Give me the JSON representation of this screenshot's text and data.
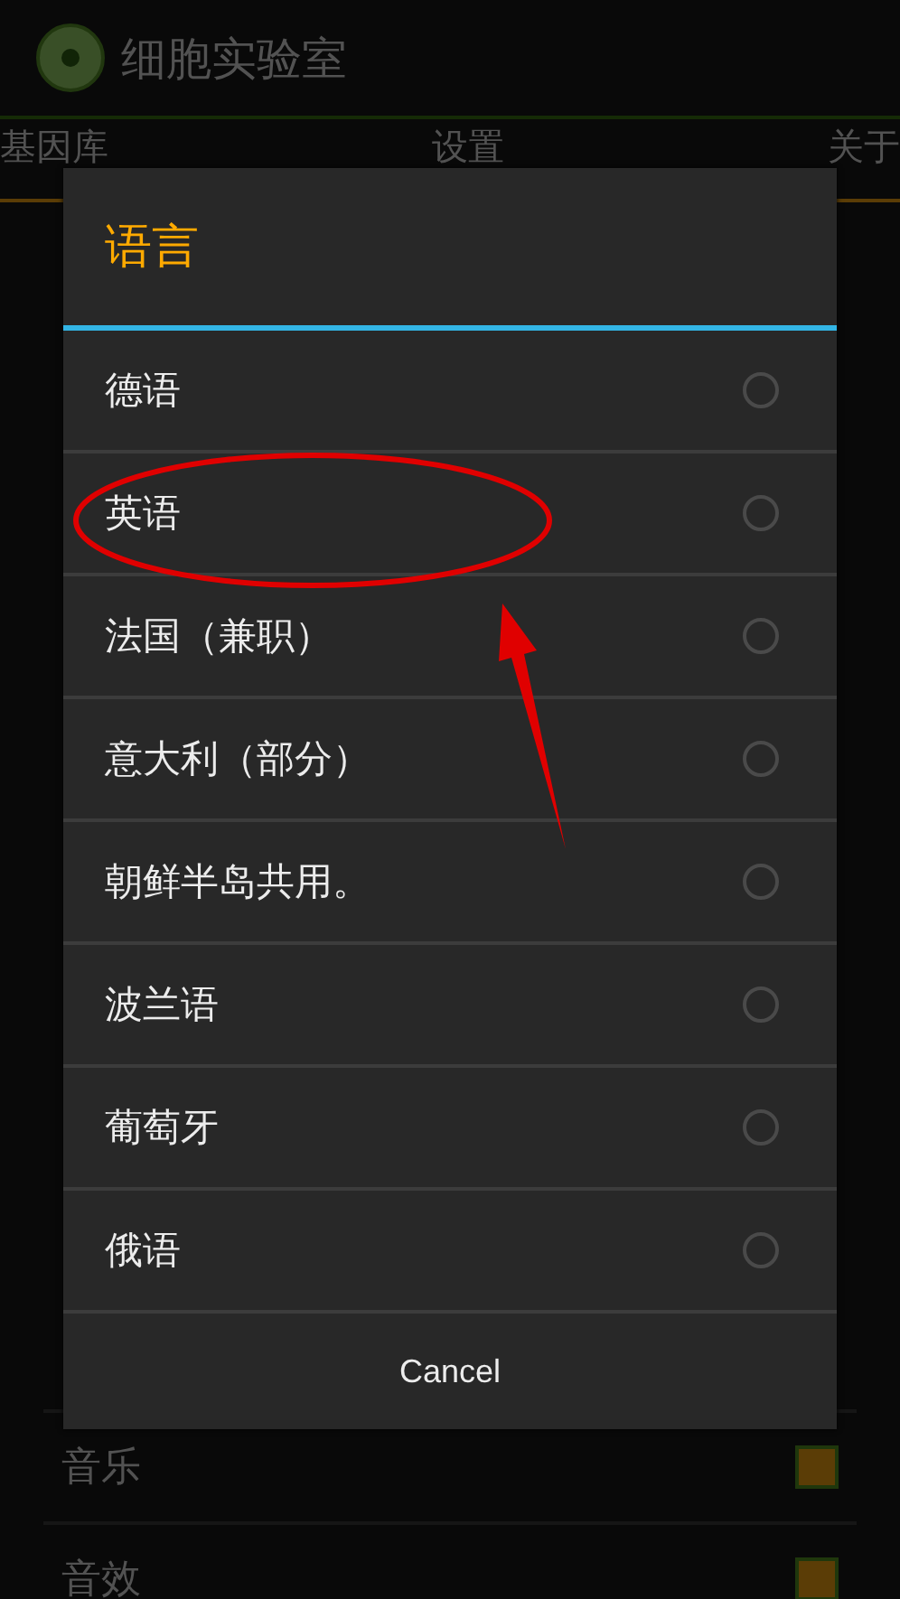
{
  "app_bar": {
    "title": "细胞实验室"
  },
  "tabs": [
    {
      "label": "基因库"
    },
    {
      "label": "设置"
    },
    {
      "label": "关于"
    }
  ],
  "settings": [
    {
      "label": "音乐",
      "checked": true
    },
    {
      "label": "音效",
      "checked": true
    }
  ],
  "dialog": {
    "title": "语言",
    "options": [
      {
        "label": "德语",
        "selected": false
      },
      {
        "label": "英语",
        "selected": false
      },
      {
        "label": "法国（兼职）",
        "selected": false
      },
      {
        "label": "意大利（部分）",
        "selected": false
      },
      {
        "label": "朝鲜半岛共用。",
        "selected": false
      },
      {
        "label": "波兰语",
        "selected": false
      },
      {
        "label": "葡萄牙",
        "selected": false
      },
      {
        "label": "俄语",
        "selected": false
      }
    ],
    "cancel": "Cancel"
  }
}
